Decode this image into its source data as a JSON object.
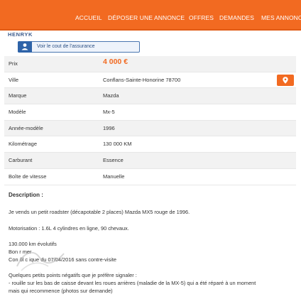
{
  "nav": {
    "items": [
      "ACCUEIL",
      "DÉPOSER UNE ANNONCE",
      "OFFRES",
      "DEMANDES",
      "MES ANNONC"
    ],
    "active": "OFFRES"
  },
  "seller": {
    "name": "HENRYK"
  },
  "insurance": {
    "label": "Voir le cout de l'assurance",
    "icon": "user-icon"
  },
  "specs": [
    {
      "key": "Prix",
      "value": "4 000 €"
    },
    {
      "key": "Ville",
      "value": "Conflans-Sainte-Honorine 78700"
    },
    {
      "key": "Marque",
      "value": "Mazda"
    },
    {
      "key": "Modèle",
      "value": "Mx-5"
    },
    {
      "key": "Année-modèle",
      "value": "1996"
    },
    {
      "key": "Kilométrage",
      "value": "130 000 KM"
    },
    {
      "key": "Carburant",
      "value": "Essence"
    },
    {
      "key": "Boîte de vitesse",
      "value": "Manuelle"
    }
  ],
  "colors": {
    "accent": "#f26a21",
    "link": "#2e63a8"
  },
  "description": {
    "title": "Description :",
    "lines": [
      "Je vends un petit roadster (décapotable 2 places) Mazda MX5 rouge de 1996.",
      "Motorisation : 1.6L 4 cylindres en ligne, 90 chevaux.",
      "130.000 km évolutifs",
      "Bon  r  mer",
      "Con  ôl  c  ique du 07/04/2016 sans contre-visite",
      "Quelques petits points négatifs que je préfère signaler :",
      "- rouille sur les bas de caisse devant les roues arrières (maladie de la MX-5) qui a été réparé à un moment",
      "mais qui recommence (photos sur demande)"
    ]
  }
}
